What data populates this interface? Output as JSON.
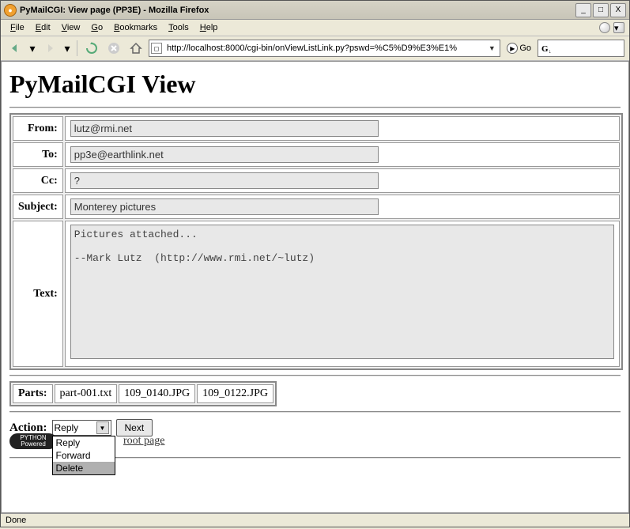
{
  "window": {
    "title": "PyMailCGI: View page (PP3E) - Mozilla Firefox",
    "min": "_",
    "max": "□",
    "close": "X"
  },
  "menubar": {
    "file": "File",
    "edit": "Edit",
    "view": "View",
    "go": "Go",
    "bookmarks": "Bookmarks",
    "tools": "Tools",
    "help": "Help"
  },
  "toolbar": {
    "url": "http://localhost:8000/cgi-bin/onViewListLink.py?pswd=%C5%D9%E3%E1%",
    "go_label": "Go"
  },
  "page": {
    "title": "PyMailCGI View",
    "labels": {
      "from": "From:",
      "to": "To:",
      "cc": "Cc:",
      "subject": "Subject:",
      "text": "Text:",
      "parts": "Parts:",
      "action": "Action:"
    },
    "from": "lutz@rmi.net",
    "to": "pp3e@earthlink.net",
    "cc": "?",
    "subject": "Monterey pictures",
    "body": "Pictures attached...\n\n--Mark Lutz  (http://www.rmi.net/~lutz)",
    "parts": [
      "part-001.txt",
      "109_0140.JPG",
      "109_0122.JPG"
    ],
    "action_selected": "Reply",
    "action_options": [
      "Reply",
      "Forward",
      "Delete"
    ],
    "next_label": "Next",
    "root_link": "root page",
    "badge_top": "PYTHON",
    "badge_bottom": "Powered"
  },
  "status": {
    "text": "Done"
  }
}
